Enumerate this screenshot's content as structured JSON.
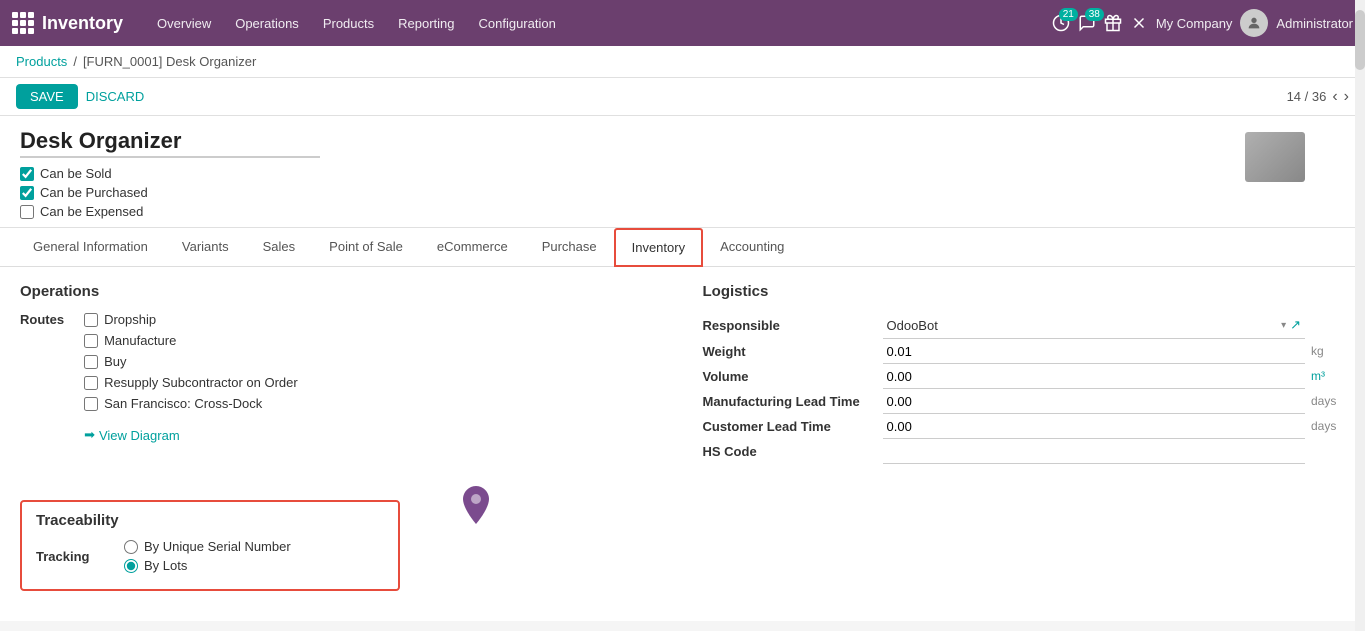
{
  "topnav": {
    "app_name": "Inventory",
    "menu_items": [
      "Overview",
      "Operations",
      "Products",
      "Reporting",
      "Configuration"
    ],
    "badge_activity": "21",
    "badge_messages": "38",
    "company": "My Company",
    "user": "Administrator"
  },
  "breadcrumb": {
    "parent": "Products",
    "current": "[FURN_0001] Desk Organizer"
  },
  "toolbar": {
    "save_label": "SAVE",
    "discard_label": "DISCARD",
    "pagination": "14 / 36"
  },
  "product": {
    "title": "Desk Organizer",
    "can_be_sold": true,
    "can_be_purchased": true,
    "can_be_expensed": false
  },
  "tabs": [
    {
      "id": "general",
      "label": "General Information",
      "active": false
    },
    {
      "id": "variants",
      "label": "Variants",
      "active": false
    },
    {
      "id": "sales",
      "label": "Sales",
      "active": false
    },
    {
      "id": "pos",
      "label": "Point of Sale",
      "active": false
    },
    {
      "id": "ecommerce",
      "label": "eCommerce",
      "active": false
    },
    {
      "id": "purchase",
      "label": "Purchase",
      "active": false
    },
    {
      "id": "inventory",
      "label": "Inventory",
      "active": true
    },
    {
      "id": "accounting",
      "label": "Accounting",
      "active": false
    }
  ],
  "inventory_tab": {
    "operations": {
      "title": "Operations",
      "routes_label": "Routes",
      "routes": [
        {
          "label": "Dropship",
          "checked": false
        },
        {
          "label": "Manufacture",
          "checked": false
        },
        {
          "label": "Buy",
          "checked": false
        },
        {
          "label": "Resupply Subcontractor on Order",
          "checked": false
        },
        {
          "label": "San Francisco: Cross-Dock",
          "checked": false
        }
      ],
      "view_diagram": "View Diagram"
    },
    "logistics": {
      "title": "Logistics",
      "fields": [
        {
          "label": "Responsible",
          "value": "OdooBot",
          "unit": "",
          "is_select": true
        },
        {
          "label": "Weight",
          "value": "0.01",
          "unit": "kg"
        },
        {
          "label": "Volume",
          "value": "0.00",
          "unit": "m³"
        },
        {
          "label": "Manufacturing Lead Time",
          "value": "0.00",
          "unit": "days"
        },
        {
          "label": "Customer Lead Time",
          "value": "0.00",
          "unit": "days"
        },
        {
          "label": "HS Code",
          "value": "",
          "unit": ""
        }
      ]
    },
    "traceability": {
      "title": "Traceability",
      "tracking_label": "Tracking",
      "options": [
        {
          "label": "By Unique Serial Number",
          "value": "serial",
          "checked": false
        },
        {
          "label": "By Lots",
          "value": "lot",
          "checked": true
        }
      ]
    }
  }
}
